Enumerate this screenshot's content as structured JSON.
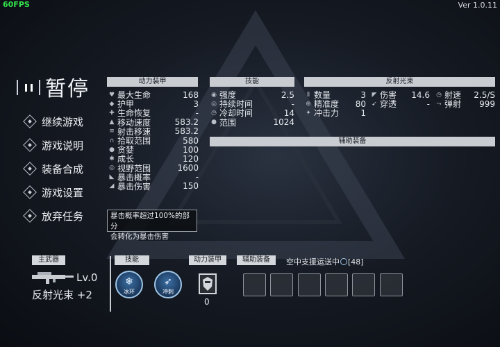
{
  "hud": {
    "fps": "60FPS",
    "version": "Ver 1.0.11"
  },
  "title": "暂停",
  "menu": [
    {
      "label": "继续游戏"
    },
    {
      "label": "游戏说明"
    },
    {
      "label": "装备合成"
    },
    {
      "label": "游戏设置"
    },
    {
      "label": "放弃任务"
    }
  ],
  "armor_panel": {
    "header": "动力装甲",
    "rows": [
      {
        "k": "最大生命",
        "v": "168",
        "icon": "heart-icon"
      },
      {
        "k": "护甲",
        "v": "3",
        "icon": "shield-icon"
      },
      {
        "k": "生命恢复",
        "v": "-",
        "icon": "regen-icon"
      },
      {
        "k": "移动速度",
        "v": "583.2",
        "icon": "boot-icon"
      },
      {
        "k": "射击移速",
        "v": "583.2",
        "icon": "gun-move-icon"
      },
      {
        "k": "拾取范围",
        "v": "580",
        "icon": "magnet-icon"
      },
      {
        "k": "贪婪",
        "v": "100",
        "icon": "coin-icon"
      },
      {
        "k": "成长",
        "v": "120",
        "icon": "growth-icon"
      },
      {
        "k": "视野范围",
        "v": "1600",
        "icon": "eye-icon"
      },
      {
        "k": "暴击概率",
        "v": "-",
        "icon": "crit-chance-icon"
      },
      {
        "k": "暴击伤害",
        "v": "150",
        "icon": "crit-damage-icon"
      }
    ]
  },
  "tooltip": {
    "line1": "暴击概率超过100%的部分",
    "line2": "会转化为暴击伤害"
  },
  "skill_panel": {
    "header": "技能",
    "rows": [
      {
        "k": "强度",
        "v": "2.5",
        "icon": "power-icon"
      },
      {
        "k": "持续时间",
        "v": "-",
        "icon": "duration-icon"
      },
      {
        "k": "冷却时间",
        "v": "14",
        "icon": "cooldown-icon"
      },
      {
        "k": "范围",
        "v": "1024",
        "icon": "range-icon"
      }
    ]
  },
  "aux_panel": {
    "header": "辅助装备"
  },
  "beam_panel": {
    "header": "反射光束",
    "col1": [
      {
        "k": "数量",
        "v": "3",
        "icon": "count-icon"
      },
      {
        "k": "精准度",
        "v": "80",
        "icon": "crosshair-icon"
      },
      {
        "k": "冲击力",
        "v": "1",
        "icon": "impact-icon"
      }
    ],
    "col2": [
      {
        "k": "伤害",
        "v": "14.6",
        "icon": "damage-icon"
      },
      {
        "k": "穿透",
        "v": "-",
        "icon": "pierce-icon"
      }
    ],
    "col3": [
      {
        "k": "射速",
        "v": "2.5/S",
        "icon": "firerate-icon"
      },
      {
        "k": "弹射",
        "v": "999",
        "icon": "bounce-icon"
      }
    ]
  },
  "bottom": {
    "main_weapon_header": "主武器",
    "weapon_level": "Lv.0",
    "weapon_name": "反射光束 +2",
    "skills_header": "技能",
    "skills": [
      {
        "label": "冰环"
      },
      {
        "label": "冲刺"
      }
    ],
    "armor_header": "动力装甲",
    "armor_count": "0",
    "aux_header": "辅助装备",
    "airdrop_text": "空中支援运送中",
    "airdrop_count": "[48]"
  }
}
